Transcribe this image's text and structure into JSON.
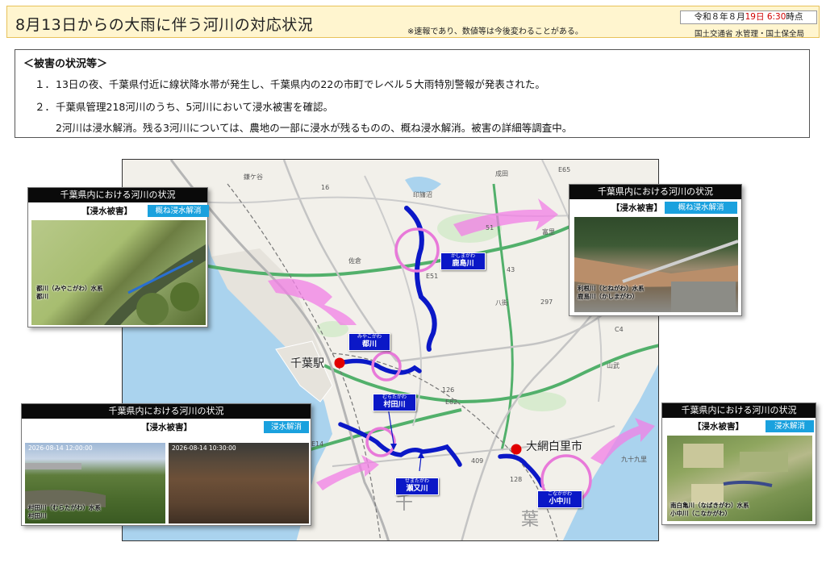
{
  "header": {
    "title": "8月13日からの大雨に伴う河川の対応状況",
    "note": "※速報であり、数値等は今後変わることがある。",
    "date_prefix": "令和８年８月",
    "date_day": "19日",
    "date_time": "6:30",
    "date_suffix": "時点",
    "org": "国土交通省 水管理・国土保全局"
  },
  "damage": {
    "heading": "＜被害の状況等＞",
    "items": [
      {
        "num": "１．",
        "text": "13日の夜、千葉県付近に線状降水帯が発生し、千葉県内の22の市町でレベル５大雨特別警報が発表された。"
      },
      {
        "num": "２．",
        "text": "千葉県管理218河川のうち、5河川において浸水被害を確認。"
      },
      {
        "num": "",
        "text": "2河川は浸水解消。残る3河川については、農地の一部に浸水が残るものの、概ね浸水解消。被害の詳細等調査中。"
      }
    ]
  },
  "panels": [
    {
      "title": "千葉県内における河川の状況",
      "subtitle": "【浸水被害】",
      "status": "概ね浸水解消",
      "caption": [
        "都川（みやこがわ）水系",
        "都川"
      ]
    },
    {
      "title": "千葉県内における河川の状況",
      "subtitle": "【浸水被害】",
      "status": "概ね浸水解消",
      "caption": [
        "利根川（とねがわ）水系",
        "鹿島川（かしまがわ）"
      ]
    },
    {
      "title": "千葉県内における河川の状況",
      "subtitle": "【浸水被害】",
      "status": "浸水解消",
      "caption": [
        "村田川（むらたがわ）水系",
        "村田川"
      ],
      "photo_stamps": [
        "2026-08-14 12:00:00",
        "2026-08-14 10:30:00"
      ]
    },
    {
      "title": "千葉県内における河川の状況",
      "subtitle": "【浸水被害】",
      "status": "浸水解消",
      "caption": [
        "南白亀川（なばきがわ）水系",
        "小中川（こなかがわ）"
      ]
    }
  ],
  "map": {
    "stations": [
      {
        "name": "千葉駅"
      },
      {
        "name": "大網白里市"
      }
    ],
    "rivers": [
      {
        "reading": "かしまがわ",
        "name": "鹿島川"
      },
      {
        "reading": "みやこがわ",
        "name": "都川"
      },
      {
        "reading": "むらたがわ",
        "name": "村田川"
      },
      {
        "reading": "せまたがわ",
        "name": "瀬又川"
      },
      {
        "reading": "こなかがわ",
        "name": "小中川"
      }
    ],
    "places": [
      "佐倉",
      "八街",
      "山武",
      "千",
      "葉",
      "印旛沼",
      "成田",
      "鎌ケ谷",
      "富里",
      "九十九里"
    ],
    "road_labels": [
      "E51",
      "E14",
      "E82",
      "126",
      "16",
      "51",
      "43",
      "C4",
      "E65",
      "409",
      "128",
      "297"
    ],
    "colors": {
      "river": "#0b18c7",
      "highlight": "#e879d9",
      "arrow": "#f27fe6",
      "sea": "#aad3ee",
      "badge": "#1aa1de",
      "station": "#e10000"
    }
  }
}
